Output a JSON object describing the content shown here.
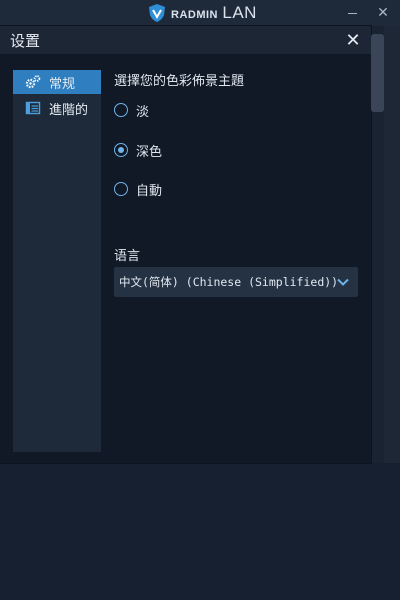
{
  "app": {
    "brand_small": "RADMIN",
    "brand_big": "LAN",
    "minimize_glyph": "—",
    "close_glyph": "✕"
  },
  "dialog": {
    "title": "设置",
    "close_glyph": "✕"
  },
  "nav": {
    "items": [
      {
        "label": "常规",
        "icon": "gears-icon",
        "active": true
      },
      {
        "label": "進階的",
        "icon": "advanced-list-icon",
        "active": false
      }
    ]
  },
  "theme": {
    "title": "選擇您的色彩佈景主題",
    "options": [
      {
        "label": "淡",
        "selected": false
      },
      {
        "label": "深色",
        "selected": true
      },
      {
        "label": "自動",
        "selected": false
      }
    ]
  },
  "language": {
    "label": "语言",
    "selected": "中文(简体) (Chinese (Simplified))"
  },
  "colors": {
    "accent": "#2f7fc0",
    "radio": "#6fb3e8",
    "background": "#111927"
  }
}
